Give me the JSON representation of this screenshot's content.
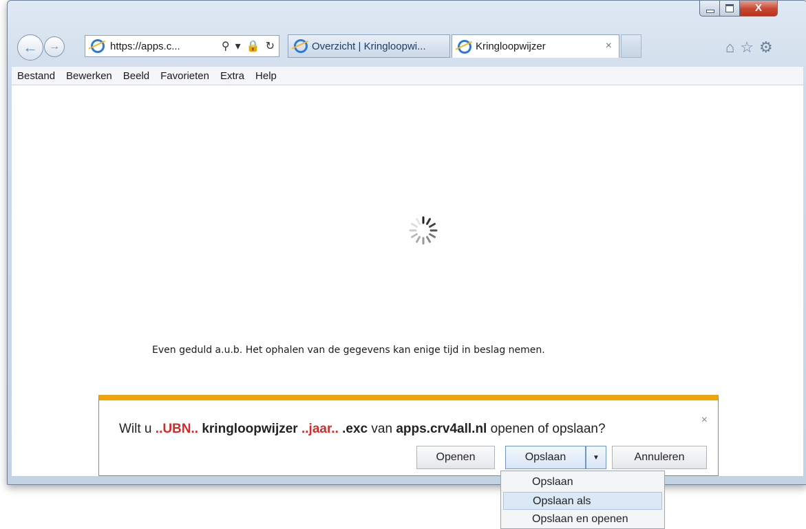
{
  "window": {
    "minimize_icon": "minimize-icon",
    "maximize_icon": "maximize-icon",
    "close_glyph": "X"
  },
  "nav": {
    "address_url": "https://apps.c...",
    "back_icon": "back-arrow-icon",
    "forward_icon": "forward-arrow-icon"
  },
  "tabs": [
    {
      "label": "Overzicht | Kringloopwi..."
    },
    {
      "label": "Kringloopwijzer",
      "close": "×"
    }
  ],
  "menu": [
    "Bestand",
    "Bewerken",
    "Beeld",
    "Favorieten",
    "Extra",
    "Help"
  ],
  "content": {
    "wait_text": "Even geduld a.u.b. Het ophalen van de gegevens kan enige tijd in beslag nemen."
  },
  "download": {
    "prefix": "Wilt u",
    "ubn": "..UBN..",
    "name": "kringloopwijzer",
    "year": "..jaar..",
    "ext": ".exc",
    "van": "van",
    "site": "apps.crv4all.nl",
    "suffix": "openen of opslaan?",
    "close": "×",
    "open_label": "Openen",
    "save_label": "Opslaan",
    "cancel_label": "Annuleren"
  },
  "save_menu": [
    "Opslaan",
    "Opslaan als",
    "Opslaan en openen"
  ],
  "colors": {
    "accent_bar": "#f0a30a",
    "highlight_text": "#d62b2b",
    "close_button": "#c9452f"
  }
}
